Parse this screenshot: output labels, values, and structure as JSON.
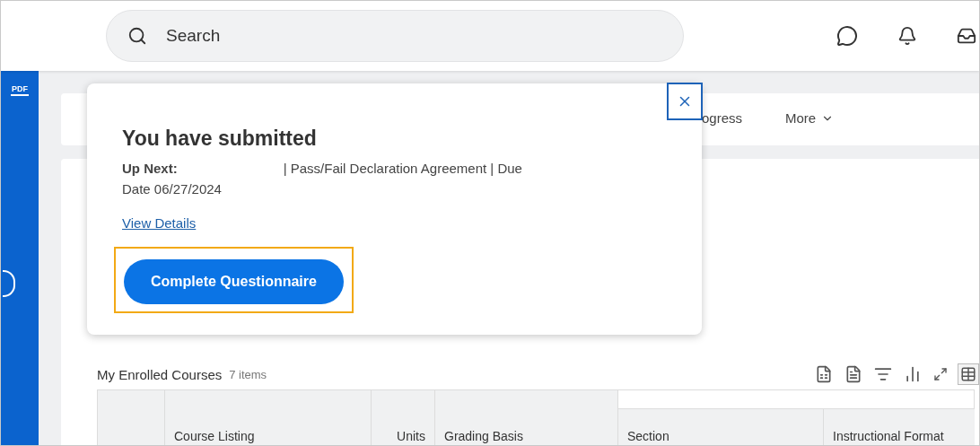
{
  "search": {
    "placeholder": "Search"
  },
  "sidebar": {
    "badge": "PDF"
  },
  "tabs": [
    {
      "label": "ogress",
      "selected": false,
      "kind": "tab"
    },
    {
      "label": "More",
      "selected": false,
      "kind": "menu"
    }
  ],
  "popup": {
    "title": "You have submitted",
    "up_next_label": "Up Next:",
    "up_next_text": "| Pass/Fail Declaration Agreement | Due Date 06/27/2024",
    "link": "View Details",
    "button": "Complete Questionnaire",
    "highlighted": true
  },
  "table": {
    "title": "My Enrolled Courses",
    "count": "7 items",
    "columns": [
      "",
      "Course Listing",
      "Units",
      "Grading Basis",
      "Section",
      "Instructional Format"
    ]
  }
}
